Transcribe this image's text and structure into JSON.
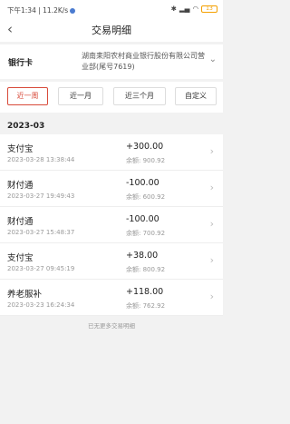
{
  "status_bar": {
    "left_text": "下午1:34 | 11.2K/s",
    "battery": "13"
  },
  "header": {
    "title": "交易明细",
    "back_icon": "chevron-left-icon"
  },
  "account": {
    "label": "银行卡",
    "value": "湖南耒阳农村商业银行股份有限公司营业部(尾号7619)"
  },
  "filters": {
    "items": [
      "近一周",
      "近一月",
      "近三个月",
      "自定义"
    ],
    "active_index": 0,
    "accent_color": "#d84a3a"
  },
  "month_header": "2023-03",
  "transactions": [
    {
      "name": "支付宝",
      "time": "2023-03-28 13:38:44",
      "amount": "+300.00",
      "balance": "余额: 900.92"
    },
    {
      "name": "财付通",
      "time": "2023-03-27 19:49:43",
      "amount": "-100.00",
      "balance": "余额: 600.92"
    },
    {
      "name": "财付通",
      "time": "2023-03-27 15:48:37",
      "amount": "-100.00",
      "balance": "余额: 700.92"
    },
    {
      "name": "支付宝",
      "time": "2023-03-27 09:45:19",
      "amount": "+38.00",
      "balance": "余额: 800.92"
    },
    {
      "name": "养老服补",
      "time": "2023-03-23 16:24:34",
      "amount": "+118.00",
      "balance": "余额: 762.92"
    }
  ],
  "footer_note": "已无更多交易明细"
}
